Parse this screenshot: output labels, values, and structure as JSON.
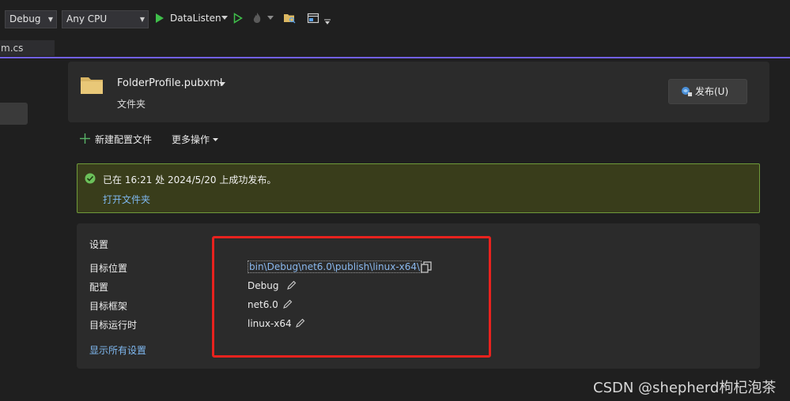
{
  "toolbar": {
    "config_combo": "Debug",
    "platform_combo": "Any CPU",
    "run_target": "DataListen"
  },
  "tabs": [
    {
      "label": "m.cs"
    }
  ],
  "profile": {
    "name": "FolderProfile.pubxml",
    "type": "文件夹",
    "publish_label": "发布(U)"
  },
  "actions": {
    "new_profile": "新建配置文件",
    "more_actions": "更多操作"
  },
  "banner": {
    "message": "已在 16:21 处 2024/5/20 上成功发布。",
    "open_folder": "打开文件夹"
  },
  "settings": {
    "title": "设置",
    "rows": [
      {
        "label": "目标位置",
        "value": "bin\\Debug\\net6.0\\publish\\linux-x64\\"
      },
      {
        "label": "配置",
        "value": "Debug"
      },
      {
        "label": "目标框架",
        "value": "net6.0"
      },
      {
        "label": "目标运行时",
        "value": "linux-x64"
      }
    ],
    "show_all": "显示所有设置"
  },
  "watermark": "CSDN @shepherd枸杞泡茶",
  "colors": {
    "accent": "#7160e8",
    "success_border": "#6f9a3a",
    "link": "#7fb8f0",
    "highlight_box": "#e8221e"
  }
}
